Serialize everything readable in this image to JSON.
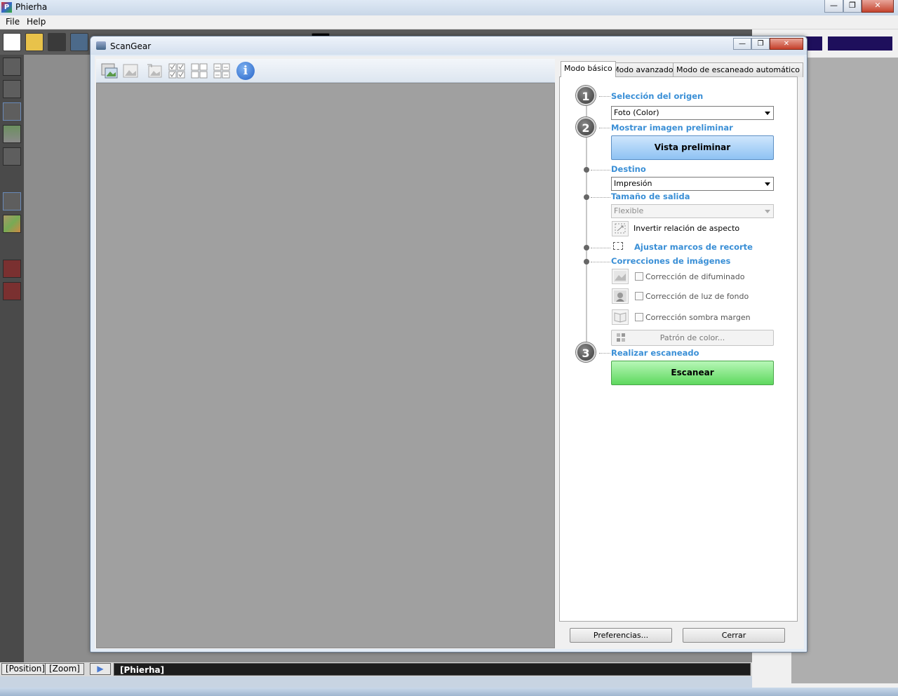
{
  "app": {
    "title": "Phierha",
    "logo": "P",
    "menu": [
      "File",
      "Help"
    ],
    "window_buttons": {
      "minimize": "—",
      "maximize": "❐",
      "close": "✕"
    }
  },
  "status_bar": {
    "position_label": "[Position]",
    "zoom_label": "[Zoom]",
    "play_icon": "▶",
    "title": "[Phierha]"
  },
  "dialog": {
    "title": "ScanGear",
    "window_buttons": {
      "minimize": "—",
      "maximize": "❐",
      "close": "✕"
    },
    "info_icon": "i",
    "tabs": [
      "Modo básico",
      "Modo avanzado",
      "Modo de escaneado automático"
    ],
    "step1": {
      "number": "1",
      "title": "Selección del origen",
      "value": "Foto (Color)"
    },
    "step2": {
      "number": "2",
      "title": "Mostrar imagen preliminar",
      "button": "Vista preliminar"
    },
    "destino": {
      "title": "Destino",
      "value": "Impresión"
    },
    "tamano": {
      "title": "Tamaño de salida",
      "value": "Flexible",
      "invert_label": "Invertir relación de aspecto"
    },
    "ajustar": {
      "title": "Ajustar marcos de recorte"
    },
    "correcciones": {
      "title": "Correcciones de imágenes",
      "items": [
        "Corrección de difuminado",
        "Corrección de luz de fondo",
        "Corrección sombra margen"
      ],
      "pattern_button": "Patrón de color..."
    },
    "step3": {
      "number": "3",
      "title": "Realizar escaneado",
      "button": "Escanear"
    },
    "footer": {
      "preferences": "Preferencias...",
      "close": "Cerrar"
    },
    "colors": {
      "section_title": "#3a8fd6",
      "preview_button": "#8ec2f3",
      "scan_button": "#5ed85e"
    }
  }
}
